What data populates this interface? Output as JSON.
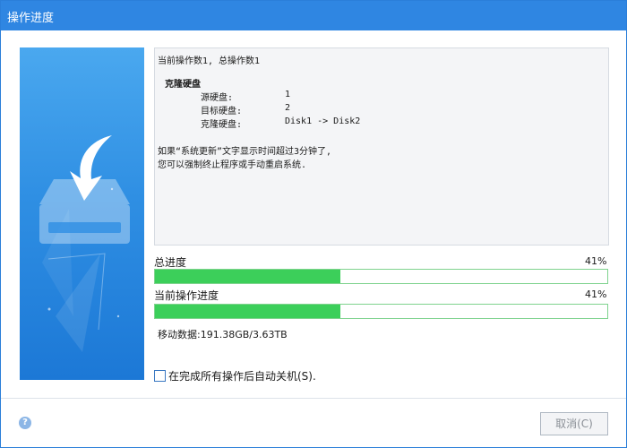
{
  "window": {
    "title": "操作进度"
  },
  "summary": {
    "line1": "当前操作数1, 总操作数1",
    "section_title": "克隆硬盘",
    "source_label": "源硬盘:",
    "source_value": "1",
    "target_label": "目标硬盘:",
    "target_value": "2",
    "clone_label": "克隆硬盘:",
    "clone_value": "Disk1 -> Disk2",
    "note1": "如果“系统更新”文字显示时间超过3分钟了,",
    "note2": "您可以强制终止程序或手动重启系统."
  },
  "overall_progress": {
    "label": "总进度",
    "percent_text": "41%",
    "value": 0.41
  },
  "current_progress": {
    "label": "当前操作进度",
    "percent_text": "41%",
    "value": 0.41
  },
  "moved_data": {
    "text": "移动数据:191.38GB/3.63TB"
  },
  "shutdown_option": {
    "label": "在完成所有操作后自动关机(S).",
    "checked": false
  },
  "footer": {
    "help_glyph": "?",
    "cancel_label": "取消(C)"
  },
  "colors": {
    "titlebar": "#2f86e2",
    "progress_fill": "#3ccf5a",
    "side_panel": "#2f8fe3"
  }
}
